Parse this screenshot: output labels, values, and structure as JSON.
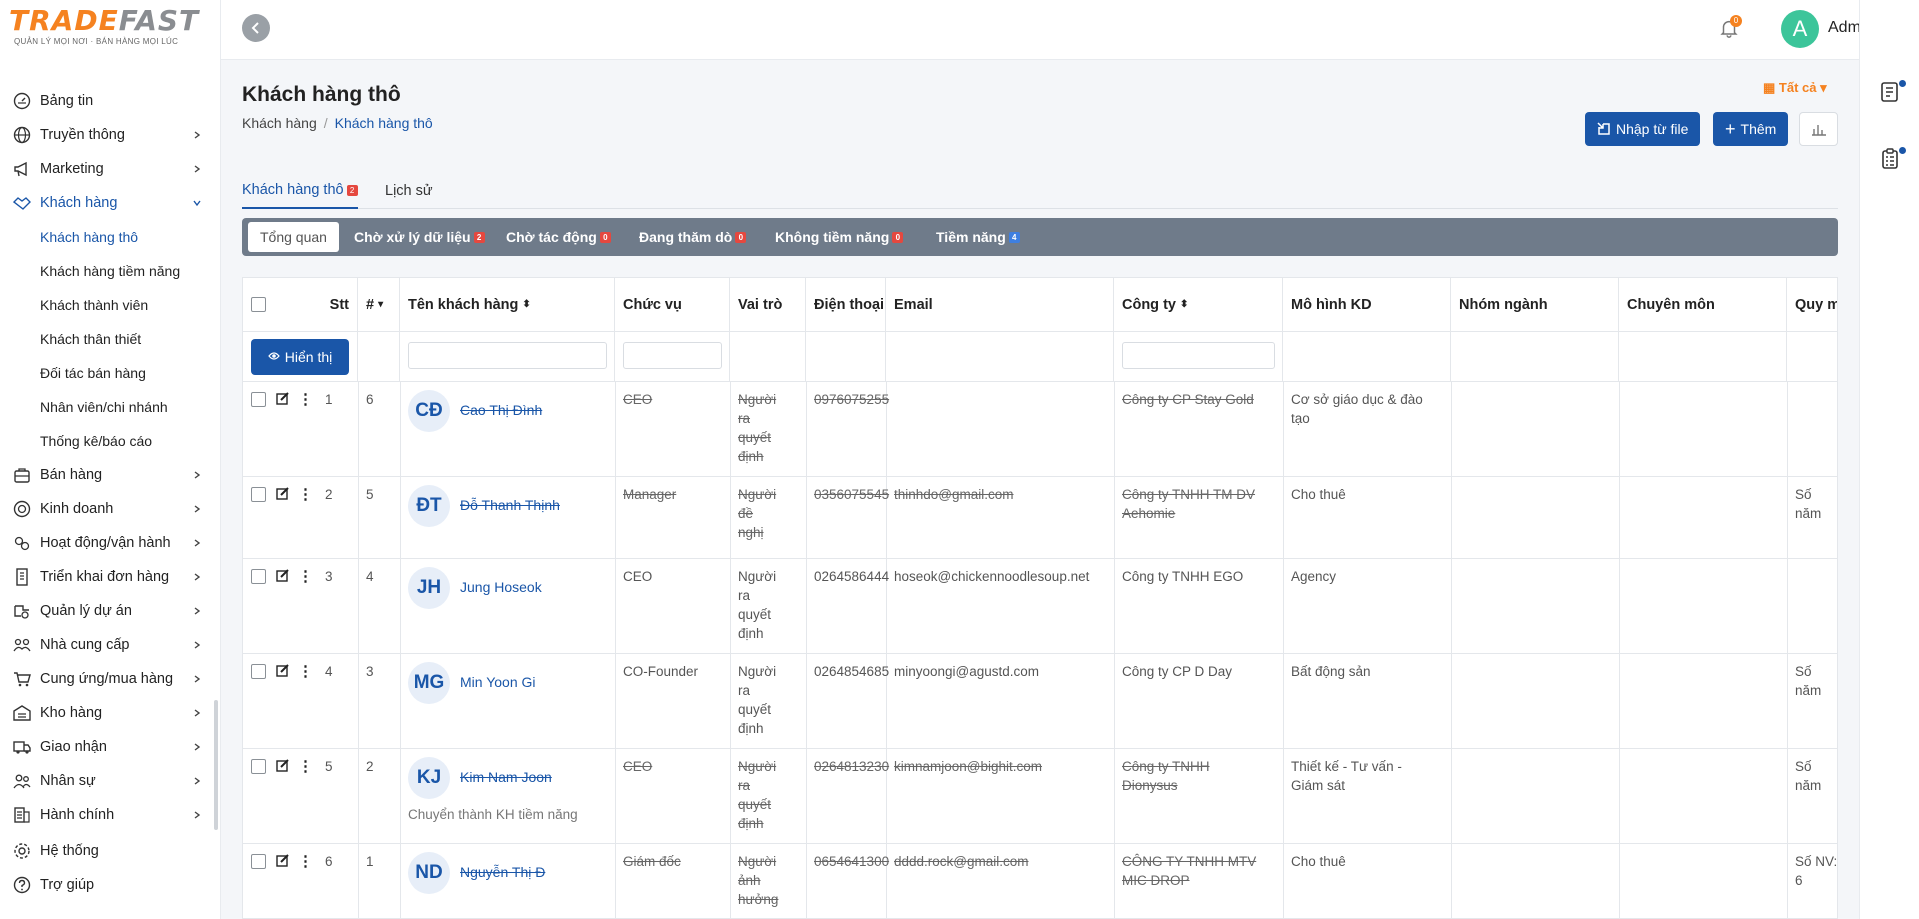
{
  "logo": {
    "part1": "TRADE",
    "part2": "FAST",
    "tagline": "QUẢN LÝ MỌI NƠI · BÁN HÀNG MỌI LÚC"
  },
  "sidebar": {
    "items": [
      {
        "label": "Bảng tin",
        "icon": "dashboard-icon",
        "chevron": false
      },
      {
        "label": "Truyền thông",
        "icon": "globe-icon",
        "chevron": true
      },
      {
        "label": "Marketing",
        "icon": "megaphone-icon",
        "chevron": true
      },
      {
        "label": "Khách hàng",
        "icon": "handshake-icon",
        "chevron": true,
        "active": true
      }
    ],
    "sub_items": [
      {
        "label": "Khách hàng thô",
        "active": true
      },
      {
        "label": "Khách hàng tiềm năng"
      },
      {
        "label": "Khách thành viên"
      },
      {
        "label": "Khách thân thiết"
      },
      {
        "label": "Đối tác bán hàng"
      },
      {
        "label": "Nhân viên/chi nhánh"
      },
      {
        "label": "Thống kê/báo cáo"
      }
    ],
    "items_after": [
      {
        "label": "Bán hàng",
        "icon": "briefcase-icon"
      },
      {
        "label": "Kinh doanh",
        "icon": "target-icon"
      },
      {
        "label": "Hoạt động/vận hành",
        "icon": "gears-icon"
      },
      {
        "label": "Triển khai đơn hàng",
        "icon": "building-icon"
      },
      {
        "label": "Quản lý dự án",
        "icon": "project-icon"
      },
      {
        "label": "Nhà cung cấp",
        "icon": "supplier-icon"
      },
      {
        "label": "Cung ứng/mua hàng",
        "icon": "cart-icon"
      },
      {
        "label": "Kho hàng",
        "icon": "warehouse-icon"
      },
      {
        "label": "Giao nhận",
        "icon": "truck-icon"
      },
      {
        "label": "Nhân sự",
        "icon": "people-icon"
      },
      {
        "label": "Hành chính",
        "icon": "admin-icon"
      }
    ],
    "footer": [
      {
        "label": "Hệ thống",
        "icon": "gear-icon"
      },
      {
        "label": "Trợ giúp",
        "icon": "help-icon"
      }
    ]
  },
  "topbar": {
    "bell_count": "0",
    "avatar_letter": "A",
    "user_name": "Admin"
  },
  "page": {
    "title": "Khách hàng thô",
    "breadcrumb": [
      "Khách hàng",
      "Khách hàng thô"
    ],
    "filter_all": "Tất cả",
    "import_label": "Nhập từ file",
    "add_label": "Thêm"
  },
  "tabs": [
    {
      "label": "Khách hàng thô",
      "badge": "2"
    },
    {
      "label": "Lịch sử"
    }
  ],
  "status_filters": [
    {
      "label": "Tổng quan"
    },
    {
      "label": "Chờ xử lý dữ liệu",
      "badge": "2",
      "badge_color": "red"
    },
    {
      "label": "Chờ tác động",
      "badge": "0",
      "badge_color": "red"
    },
    {
      "label": "Đang thăm dò",
      "badge": "0",
      "badge_color": "red"
    },
    {
      "label": "Không tiềm năng",
      "badge": "0",
      "badge_color": "red"
    },
    {
      "label": "Tiềm năng",
      "badge": "4",
      "badge_color": "blue"
    }
  ],
  "table": {
    "columns": [
      "Stt",
      "#",
      "Tên khách hàng",
      "Chức vụ",
      "Vai trò",
      "Điện thoại",
      "Email",
      "Công ty",
      "Mô hình KD",
      "Nhóm ngành",
      "Chuyên môn",
      "Quy mô"
    ],
    "show_button": "Hiển thị",
    "rows": [
      {
        "stt": "1",
        "num": "6",
        "initials": "CĐ",
        "name": "Cao Thị Đình",
        "position": "CEO",
        "role": [
          "Người",
          "ra",
          "quyết",
          "định"
        ],
        "phone": "0976075255",
        "email": "",
        "company": [
          "Công ty CP Stay Gold"
        ],
        "business": [
          "Cơ sở giáo dục & đào",
          "tạo"
        ],
        "scale": "",
        "struck": true,
        "note": ""
      },
      {
        "stt": "2",
        "num": "5",
        "initials": "ĐT",
        "name": "Đỗ Thanh Thịnh",
        "position": "Manager",
        "role": [
          "Người",
          "đề",
          "nghị"
        ],
        "phone": "0356075545",
        "email": "thinhdo@gmail.com",
        "company": [
          "Công ty TNHH TM DV",
          "Aehomie"
        ],
        "business": [
          "Cho thuê"
        ],
        "scale": "Số năm",
        "struck": true,
        "note": ""
      },
      {
        "stt": "3",
        "num": "4",
        "initials": "JH",
        "name": "Jung Hoseok",
        "position": "CEO",
        "role": [
          "Người",
          "ra",
          "quyết",
          "định"
        ],
        "phone": "0264586444",
        "email": "hoseok@chickennoodlesoup.net",
        "company": [
          "Công ty TNHH EGO"
        ],
        "business": [
          "Agency"
        ],
        "scale": "",
        "struck": false,
        "note": ""
      },
      {
        "stt": "4",
        "num": "3",
        "initials": "MG",
        "name": "Min Yoon Gi",
        "position": "CO-Founder",
        "role": [
          "Người",
          "ra",
          "quyết",
          "định"
        ],
        "phone": "0264854685",
        "email": "minyoongi@agustd.com",
        "company": [
          "Công ty CP D Day"
        ],
        "business": [
          "Bất động sản"
        ],
        "scale": "Số năm",
        "struck": false,
        "note": ""
      },
      {
        "stt": "5",
        "num": "2",
        "initials": "KJ",
        "name": "Kim Nam Joon",
        "position": "CEO",
        "role": [
          "Người",
          "ra",
          "quyết",
          "định"
        ],
        "phone": "0264813230",
        "email": "kimnamjoon@bighit.com",
        "company": [
          "Công ty TNHH",
          "Dionysus"
        ],
        "business": [
          "Thiết kế - Tư vấn -",
          "Giám sát"
        ],
        "scale": "Số năm",
        "struck": true,
        "note": "Chuyển thành KH tiềm năng"
      },
      {
        "stt": "6",
        "num": "1",
        "initials": "ND",
        "name": "Nguyễn Thị Đ",
        "position": "Giám đốc",
        "role": [
          "Người",
          "ảnh",
          "hưởng"
        ],
        "phone": "0654641300",
        "email": "dddd.rock@gmail.com",
        "company": [
          "CÔNG TY TNHH MTV",
          "MIC DROP"
        ],
        "business": [
          "Cho thuê"
        ],
        "scale": "Số NV: 6",
        "struck": true,
        "note": ""
      }
    ]
  },
  "colors": {
    "primary": "#1a56a8",
    "accent": "#f58220",
    "status_bar": "#6f7b8a"
  }
}
